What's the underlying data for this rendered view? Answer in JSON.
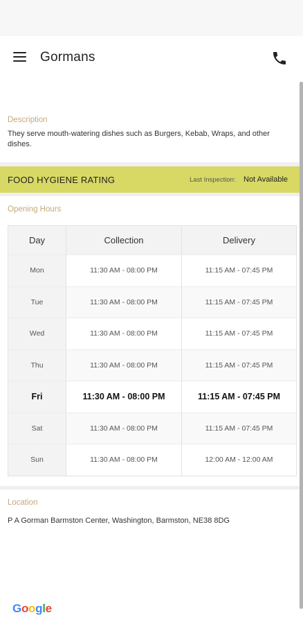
{
  "app": {
    "title": "Gormans"
  },
  "description": {
    "label": "Description",
    "text": "They serve mouth-watering dishes such as Burgers, Kebab, Wraps,  and other dishes."
  },
  "hygiene": {
    "title": "FOOD HYGIENE RATING",
    "last_inspection_label": "Last Inspection:",
    "last_inspection_value": "Not Available",
    "color": "#d7d964"
  },
  "opening_hours": {
    "label": "Opening Hours",
    "headers": [
      "Day",
      "Collection",
      "Delivery"
    ],
    "rows": [
      {
        "day": "Mon",
        "collection": "11:30 AM - 08:00 PM",
        "delivery": "11:15 AM - 07:45 PM"
      },
      {
        "day": "Tue",
        "collection": "11:30 AM - 08:00 PM",
        "delivery": "11:15 AM - 07:45 PM"
      },
      {
        "day": "Wed",
        "collection": "11:30 AM - 08:00 PM",
        "delivery": "11:15 AM - 07:45 PM"
      },
      {
        "day": "Thu",
        "collection": "11:30 AM - 08:00 PM",
        "delivery": "11:15 AM - 07:45 PM"
      },
      {
        "day": "Fri",
        "collection": "11:30 AM - 08:00 PM",
        "delivery": "11:15 AM - 07:45 PM"
      },
      {
        "day": "Sat",
        "collection": "11:30 AM - 08:00 PM",
        "delivery": "11:15 AM - 07:45 PM"
      },
      {
        "day": "Sun",
        "collection": "11:30 AM - 08:00 PM",
        "delivery": "12:00 AM - 12:00 AM"
      }
    ],
    "highlighted_day": "Fri"
  },
  "location": {
    "label": "Location",
    "address": "P  A Gorman Barmston Center, Washington, Barmston, NE38 8DG"
  },
  "attribution": {
    "google": [
      "G",
      "o",
      "o",
      "g",
      "l",
      "e"
    ]
  },
  "colors": {
    "accent_label": "#c5a97b",
    "google_blue": "#4285f4",
    "google_red": "#ea4335",
    "google_yellow": "#fbbc05",
    "google_green": "#34a853"
  },
  "icons": {
    "menu": "hamburger-menu-icon",
    "phone": "phone-icon"
  }
}
